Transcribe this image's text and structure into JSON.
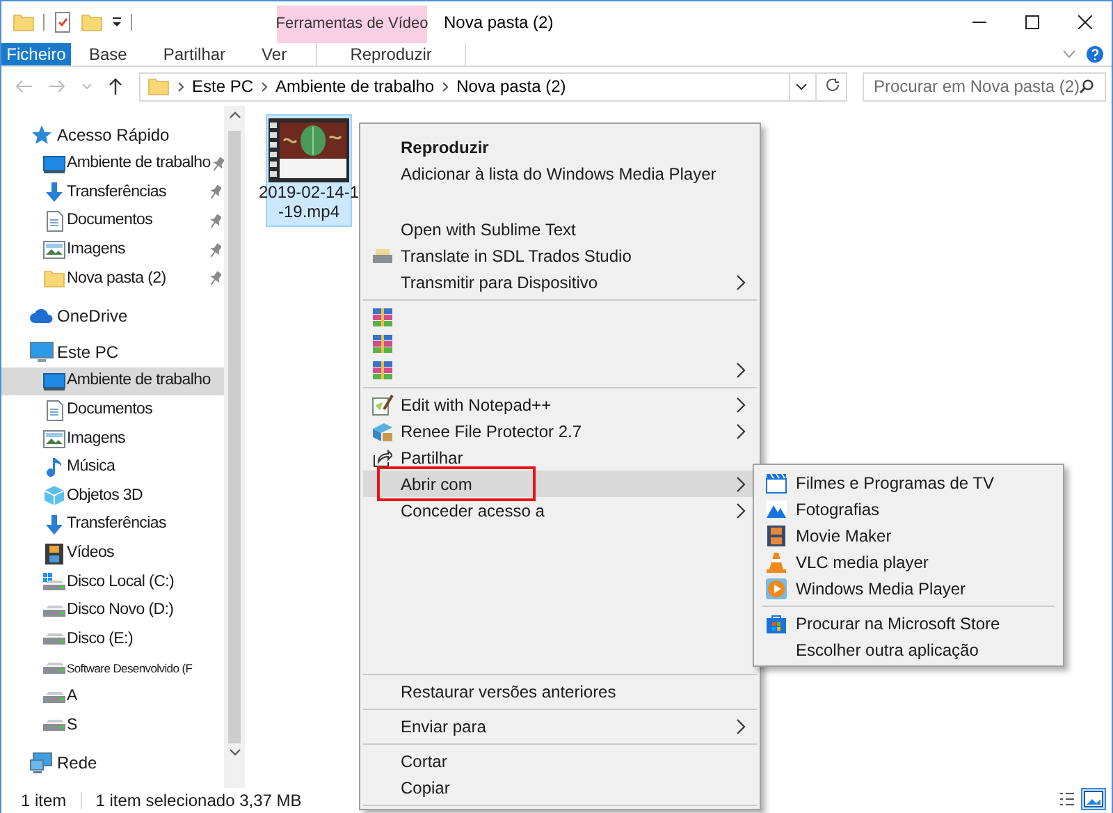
{
  "title_bar": {
    "contextual_group": "Ferramentas de Vídeo",
    "title": "Nova pasta (2)"
  },
  "ribbon_tabs": [
    {
      "label": "Ficheiro",
      "kind": "file"
    },
    {
      "label": "Base",
      "kind": "normal"
    },
    {
      "label": "Partilhar",
      "kind": "normal"
    },
    {
      "label": "Ver",
      "kind": "normal"
    },
    {
      "label": "Reproduzir",
      "kind": "contextual"
    }
  ],
  "address_bar": {
    "path": [
      "Este PC",
      "Ambiente de trabalho",
      "Nova pasta (2)"
    ]
  },
  "search": {
    "placeholder": "Procurar em Nova pasta (2)"
  },
  "navigation": [
    {
      "label": "Acesso Rápido",
      "selected": false,
      "children": [
        {
          "label": "Ambiente de trabalho",
          "pinned": true,
          "selected": false
        },
        {
          "label": "Transferências",
          "pinned": true,
          "selected": false
        },
        {
          "label": "Documentos",
          "pinned": true,
          "selected": false
        },
        {
          "label": "Imagens",
          "pinned": true,
          "selected": false
        },
        {
          "label": "Nova pasta (2)",
          "pinned": true,
          "selected": false
        }
      ]
    },
    {
      "label": "OneDrive",
      "selected": false
    },
    {
      "label": "Este PC",
      "selected": false,
      "children": [
        {
          "label": "Ambiente de trabalho",
          "selected": true
        },
        {
          "label": "Documentos",
          "selected": false
        },
        {
          "label": "Imagens",
          "selected": false
        },
        {
          "label": "Música",
          "selected": false
        },
        {
          "label": "Objetos 3D",
          "selected": false
        },
        {
          "label": "Transferências",
          "selected": false
        },
        {
          "label": "Vídeos",
          "selected": false
        },
        {
          "label": "Disco Local (C:)",
          "selected": false
        },
        {
          "label": "Disco Novo (D:)",
          "selected": false
        },
        {
          "label": "Disco (E:)",
          "selected": false
        },
        {
          "label": "Software Desenvolvido (F",
          "selected": false
        },
        {
          "label": "A",
          "selected": false
        },
        {
          "label": "S",
          "selected": false
        }
      ]
    },
    {
      "label": "Rede",
      "selected": false
    }
  ],
  "files": [
    {
      "name_lines": [
        "2019-02-14-1",
        "-19.mp4"
      ],
      "selected": true
    }
  ],
  "context_menu": [
    {
      "kind": "item",
      "label": "Reproduzir",
      "bold": true,
      "submenu": false,
      "selected": false
    },
    {
      "kind": "item",
      "label": "Adicionar à lista do Windows Media Player",
      "bold": false,
      "submenu": false,
      "selected": false
    },
    {
      "kind": "gap"
    },
    {
      "kind": "item",
      "label": "Open with Sublime Text",
      "bold": false,
      "submenu": false,
      "selected": false
    },
    {
      "kind": "item",
      "label": "Translate in SDL Trados Studio",
      "bold": false,
      "submenu": false,
      "selected": false
    },
    {
      "kind": "item",
      "label": "Transmitir para Dispositivo",
      "bold": false,
      "submenu": true,
      "selected": false
    },
    {
      "kind": "separator"
    },
    {
      "kind": "item",
      "submenu": false,
      "selected": false
    },
    {
      "kind": "item",
      "submenu": false,
      "selected": false
    },
    {
      "kind": "item",
      "submenu": true,
      "selected": false
    },
    {
      "kind": "separator"
    },
    {
      "kind": "item",
      "label": "Edit with Notepad++",
      "bold": false,
      "submenu": true,
      "selected": false
    },
    {
      "kind": "item",
      "label": "Renee File Protector 2.7",
      "bold": false,
      "submenu": true,
      "selected": false
    },
    {
      "kind": "item",
      "label": "Partilhar",
      "bold": false,
      "submenu": false,
      "selected": false
    },
    {
      "kind": "item",
      "label": "Abrir com",
      "bold": false,
      "submenu": true,
      "selected": true,
      "outlined": true,
      "open_submenu": [
        {
          "kind": "item",
          "label": "Filmes e Programas de TV"
        },
        {
          "kind": "item",
          "label": "Fotografias"
        },
        {
          "kind": "item",
          "label": "Movie Maker"
        },
        {
          "kind": "item",
          "label": "VLC media player"
        },
        {
          "kind": "item",
          "label": "Windows Media Player"
        },
        {
          "kind": "separator"
        },
        {
          "kind": "item",
          "label": "Procurar na Microsoft Store"
        },
        {
          "kind": "item",
          "label": "Escolher outra aplicação"
        }
      ]
    },
    {
      "kind": "item",
      "label": "Conceder acesso a",
      "bold": false,
      "submenu": true,
      "selected": false
    },
    {
      "kind": "gap"
    },
    {
      "kind": "gap"
    },
    {
      "kind": "gap"
    },
    {
      "kind": "gap"
    },
    {
      "kind": "gap"
    },
    {
      "kind": "separator"
    },
    {
      "kind": "item",
      "label": "Restaurar versões anteriores",
      "bold": false,
      "submenu": false,
      "selected": false
    },
    {
      "kind": "separator"
    },
    {
      "kind": "item",
      "label": "Enviar para",
      "bold": false,
      "submenu": true,
      "selected": false
    },
    {
      "kind": "separator"
    },
    {
      "kind": "item",
      "label": "Cortar",
      "bold": false,
      "submenu": false,
      "selected": false
    },
    {
      "kind": "item",
      "label": "Copiar",
      "bold": false,
      "submenu": false,
      "selected": false
    },
    {
      "kind": "separator"
    }
  ],
  "status_bar": {
    "item_count": "1 item",
    "selection": "1 item selecionado 3,37 MB"
  }
}
